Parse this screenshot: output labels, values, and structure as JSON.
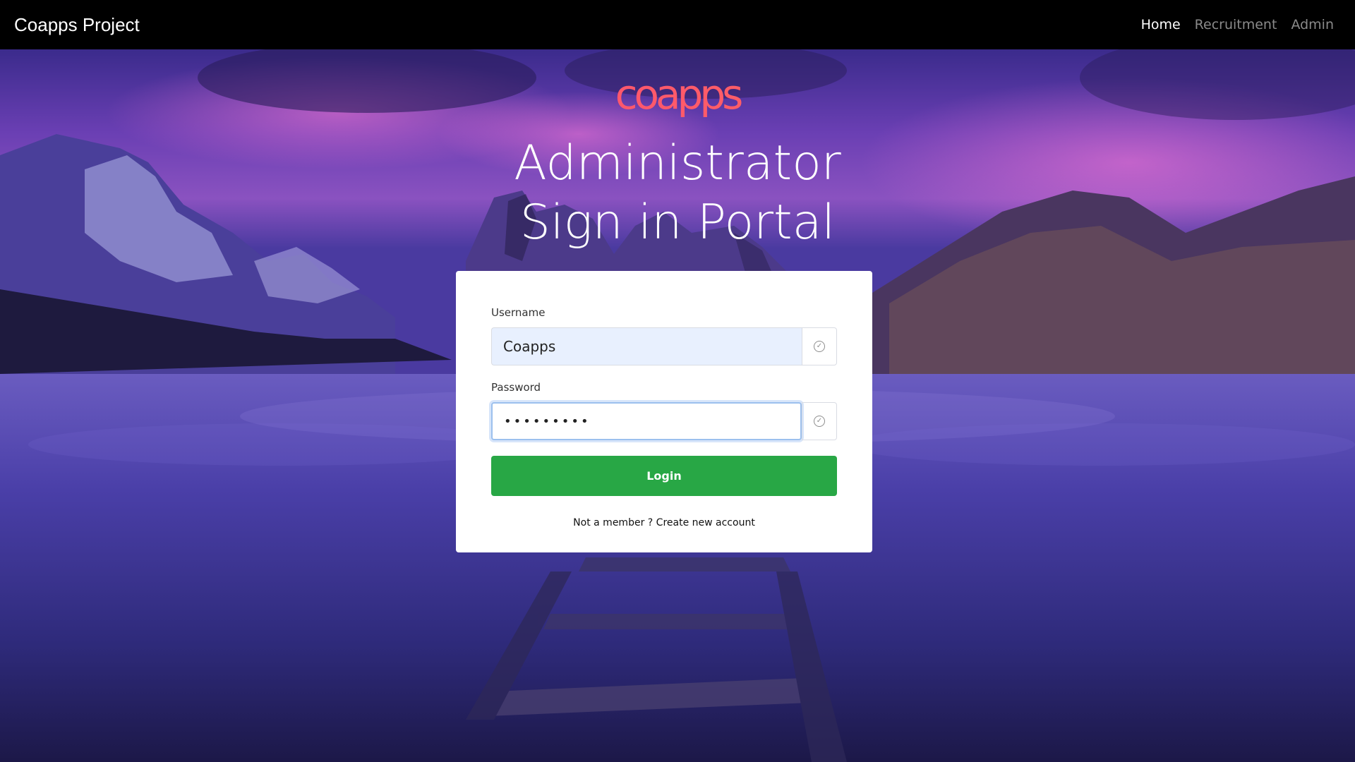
{
  "navbar": {
    "brand": "Coapps Project",
    "links": [
      {
        "label": "Home",
        "active": true
      },
      {
        "label": "Recruitment",
        "active": false
      },
      {
        "label": "Admin",
        "active": false
      }
    ]
  },
  "header": {
    "logo_text": "coapps",
    "title": "Administrator Sign in Portal"
  },
  "form": {
    "username_label": "Username",
    "username_value": "Coapps",
    "password_label": "Password",
    "password_value": "•••••••••",
    "login_label": "Login",
    "not_member_text": "Not a member ?",
    "create_account_link": "Create new account"
  },
  "colors": {
    "navbar_bg": "#000000",
    "login_button": "#28a745",
    "logo_gradient": [
      "#ff3b8a",
      "#ff7a4a"
    ]
  },
  "icons": {
    "field_status": "check-circle-icon"
  }
}
